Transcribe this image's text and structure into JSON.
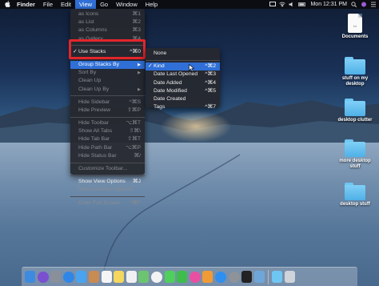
{
  "menubar": {
    "apple": "",
    "items": [
      "Finder",
      "File",
      "Edit",
      "View",
      "Go",
      "Window",
      "Help"
    ],
    "active": "View",
    "clock": "Mon 12:31 PM"
  },
  "view_menu": {
    "items": [
      {
        "label": "as Icons",
        "shortcut": "⌘1",
        "enabled": false
      },
      {
        "label": "as List",
        "shortcut": "⌘2",
        "enabled": false
      },
      {
        "label": "as Columns",
        "shortcut": "⌘3",
        "enabled": false
      },
      {
        "label": "as Gallery",
        "shortcut": "⌘4",
        "enabled": false
      },
      {
        "label": "Use Stacks",
        "shortcut": "^⌘0",
        "enabled": true,
        "checked": true
      },
      {
        "label": "Group Stacks By",
        "enabled": true,
        "highlighted": true,
        "submenu": true
      },
      {
        "label": "Sort By",
        "enabled": false,
        "submenu": true
      },
      {
        "label": "Clean Up",
        "enabled": false
      },
      {
        "label": "Clean Up By",
        "enabled": false,
        "submenu": true
      },
      {
        "label": "Hide Sidebar",
        "shortcut": "^⌘S",
        "enabled": false
      },
      {
        "label": "Hide Preview",
        "shortcut": "⇧⌘P",
        "enabled": false
      },
      {
        "label": "Hide Toolbar",
        "shortcut": "⌥⌘T",
        "enabled": false
      },
      {
        "label": "Show All Tabs",
        "shortcut": "⇧⌘\\",
        "enabled": false
      },
      {
        "label": "Hide Tab Bar",
        "shortcut": "⇧⌘T",
        "enabled": false
      },
      {
        "label": "Hide Path Bar",
        "shortcut": "⌥⌘P",
        "enabled": false
      },
      {
        "label": "Hide Status Bar",
        "shortcut": "⌘/",
        "enabled": false
      },
      {
        "label": "Customize Toolbar...",
        "enabled": false
      },
      {
        "label": "Show View Options",
        "shortcut": "⌘J",
        "enabled": true
      },
      {
        "label": "Show Preview Options",
        "enabled": false
      },
      {
        "label": "Enter Full Screen",
        "shortcut": "^⌘F",
        "enabled": false
      }
    ]
  },
  "group_submenu": {
    "items": [
      {
        "label": "None"
      },
      {
        "label": "Kind",
        "shortcut": "^⌘2",
        "checked": true,
        "highlighted": true
      },
      {
        "label": "Date Last Opened",
        "shortcut": "^⌘3"
      },
      {
        "label": "Date Added",
        "shortcut": "^⌘4"
      },
      {
        "label": "Date Modified",
        "shortcut": "^⌘5"
      },
      {
        "label": "Date Created",
        "shortcut": ""
      },
      {
        "label": "Tags",
        "shortcut": "^⌘7"
      }
    ]
  },
  "desktop": {
    "items": [
      {
        "label": "Documents",
        "type": "document",
        "ext": "txt"
      },
      {
        "label": "stuff on my desktop",
        "type": "folder"
      },
      {
        "label": "desktop clutter",
        "type": "folder"
      },
      {
        "label": "more desktop stuff",
        "type": "folder"
      },
      {
        "label": "desktop stuff",
        "type": "folder"
      }
    ]
  },
  "colors": {
    "accent": "#2f6fd6",
    "highlight_box": "#e3252b",
    "menu_bg": "#26282e"
  },
  "dock": {
    "apps": [
      "finder",
      "siri",
      "launchpad",
      "safari",
      "mail",
      "contacts",
      "calendar",
      "notes",
      "reminders",
      "maps",
      "photos",
      "messages",
      "facetime",
      "itunes",
      "ibooks",
      "app-store",
      "system-preferences",
      "terminal",
      "preview",
      "folder",
      "trash"
    ]
  }
}
